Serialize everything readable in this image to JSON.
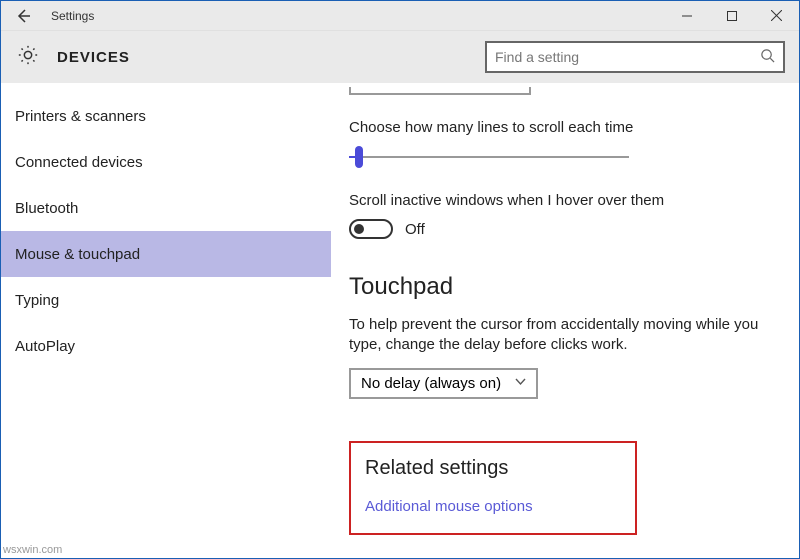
{
  "titlebar": {
    "title": "Settings"
  },
  "header": {
    "category": "DEVICES",
    "search_placeholder": "Find a setting"
  },
  "sidebar": {
    "items": [
      {
        "label": "Printers & scanners",
        "selected": false
      },
      {
        "label": "Connected devices",
        "selected": false
      },
      {
        "label": "Bluetooth",
        "selected": false
      },
      {
        "label": "Mouse & touchpad",
        "selected": true
      },
      {
        "label": "Typing",
        "selected": false
      },
      {
        "label": "AutoPlay",
        "selected": false
      }
    ]
  },
  "content": {
    "scroll_lines_label": "Choose how many lines to scroll each time",
    "inactive_label": "Scroll inactive windows when I hover over them",
    "inactive_toggle_state": "Off",
    "touchpad_heading": "Touchpad",
    "touchpad_desc": "To help prevent the cursor from accidentally moving while you type, change the delay before clicks work.",
    "delay_value": "No delay (always on)",
    "related_heading": "Related settings",
    "related_link": "Additional mouse options"
  },
  "watermark": "wsxwin.com"
}
